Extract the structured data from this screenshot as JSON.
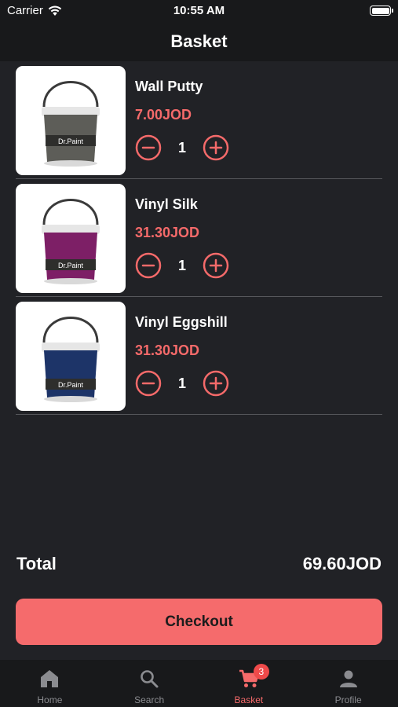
{
  "status_bar": {
    "carrier": "Carrier",
    "time": "10:55 AM"
  },
  "header": {
    "title": "Basket"
  },
  "items": [
    {
      "name": "Wall Putty",
      "price": "7.00JOD",
      "quantity": "1",
      "bucket_color": "#5d5d58",
      "brand": "Dr.Paint"
    },
    {
      "name": "Vinyl Silk",
      "price": "31.30JOD",
      "quantity": "1",
      "bucket_color": "#7d1f66",
      "brand": "Dr.Paint"
    },
    {
      "name": "Vinyl Eggshill",
      "price": "31.30JOD",
      "quantity": "1",
      "bucket_color": "#1d3468",
      "brand": "Dr.Paint"
    }
  ],
  "summary": {
    "total_label": "Total",
    "total_value": "69.60JOD"
  },
  "checkout": {
    "label": "Checkout"
  },
  "tabs": [
    {
      "label": "Home",
      "icon": "home-icon",
      "active": false
    },
    {
      "label": "Search",
      "icon": "search-icon",
      "active": false
    },
    {
      "label": "Basket",
      "icon": "cart-icon",
      "active": true,
      "badge": "3"
    },
    {
      "label": "Profile",
      "icon": "person-icon",
      "active": false
    }
  ],
  "colors": {
    "accent": "#f56a6a",
    "background": "#212226",
    "bar": "#18191b",
    "inactive_tab": "#8b8c90"
  }
}
